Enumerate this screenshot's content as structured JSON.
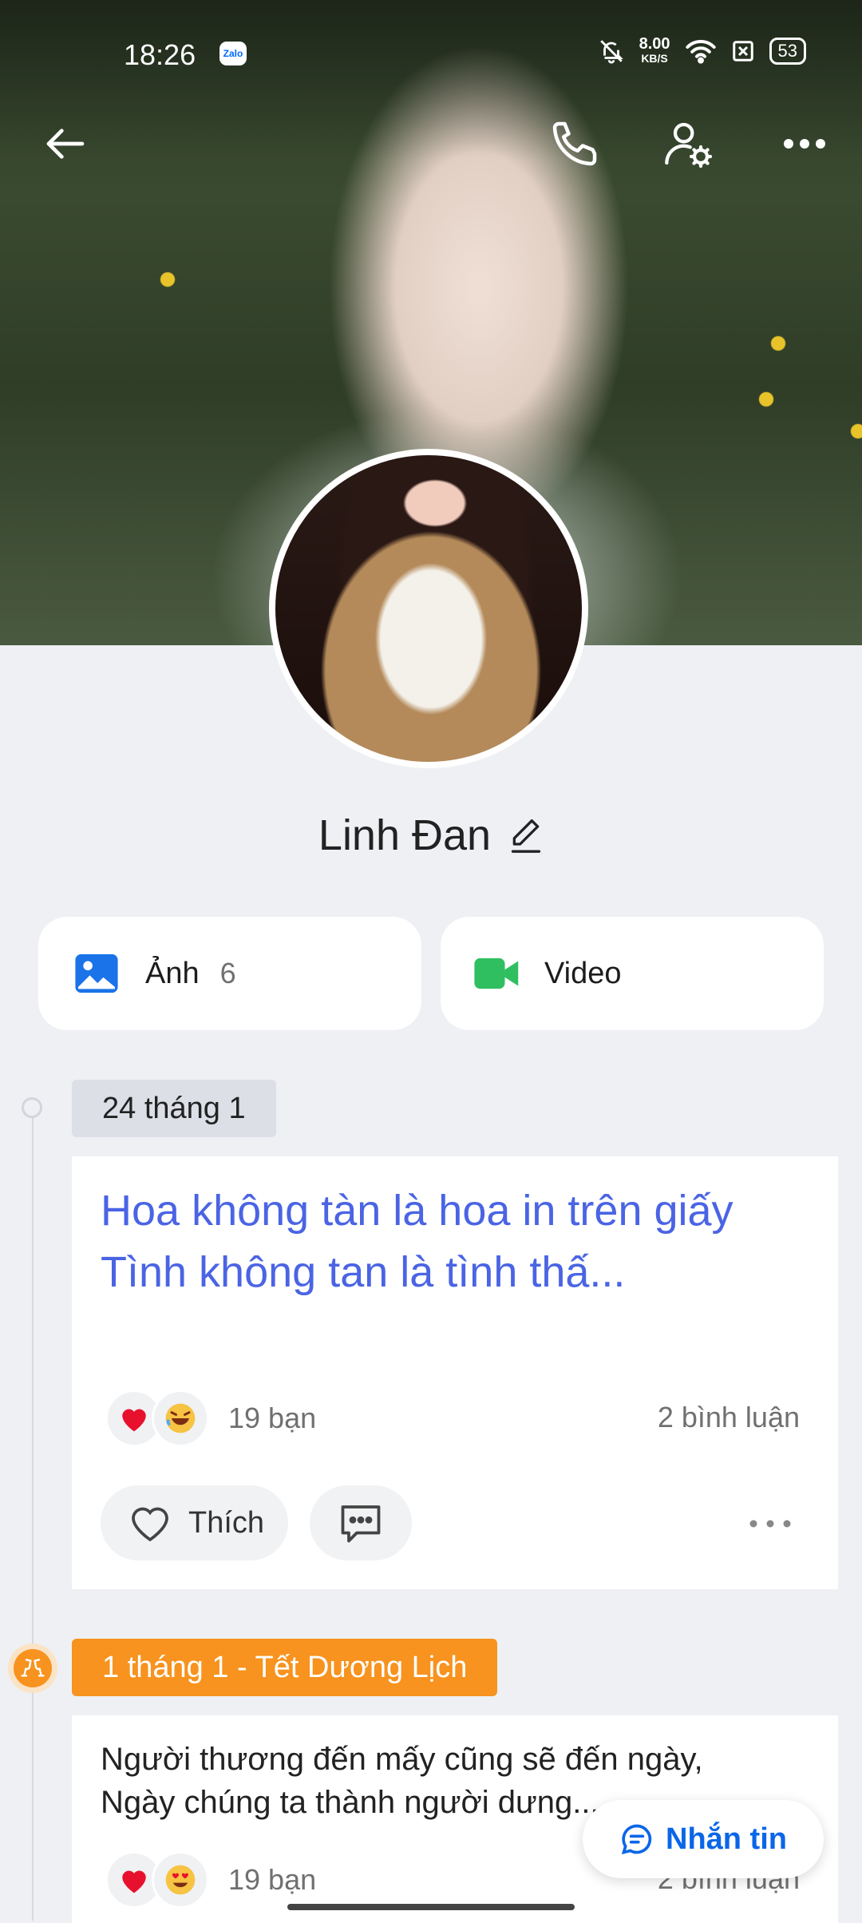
{
  "status_bar": {
    "time": "18:26",
    "app_badge": "Zalo",
    "net_speed_value": "8.00",
    "net_speed_unit": "KB/S",
    "battery": "53"
  },
  "profile": {
    "name": "Linh Đan"
  },
  "media": {
    "photos_label": "Ảnh",
    "photos_count": "6",
    "video_label": "Video"
  },
  "timeline": [
    {
      "date": "24 tháng 1",
      "text": "Hoa không tàn là hoa in trên giấy\nTình không tan là tình thấ...",
      "reactions_count": "19 bạn",
      "comments": "2 bình luận",
      "like_label": "Thích"
    },
    {
      "date": "1 tháng 1 - Tết Dương Lịch",
      "text": "Người thương đến mấy cũng sẽ đến ngày,\nNgày chúng ta thành người dưng...",
      "reactions_count": "19 bạn",
      "comments": "2 bình luận"
    }
  ],
  "fab": {
    "label": "Nhắn tin"
  },
  "colors": {
    "accent_blue": "#0a66e8",
    "post_link_blue": "#4a64e4",
    "holiday_orange": "#f7931e",
    "video_green": "#2fbf60"
  }
}
